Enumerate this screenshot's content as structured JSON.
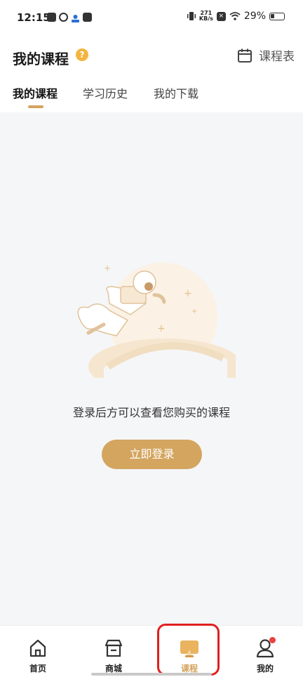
{
  "status_bar": {
    "time": "12:15",
    "speed_value": "271",
    "speed_unit": "KB/s",
    "battery": "29%"
  },
  "header": {
    "title": "我的课程",
    "help_glyph": "?",
    "schedule_label": "课程表"
  },
  "tabs": [
    {
      "label": "我的课程",
      "active": true
    },
    {
      "label": "学习历史",
      "active": false
    },
    {
      "label": "我的下载",
      "active": false
    }
  ],
  "empty_state": {
    "message": "登录后方可以查看您购买的课程",
    "button_label": "立即登录"
  },
  "bottom_nav": [
    {
      "label": "首页",
      "icon": "home-icon",
      "active": false
    },
    {
      "label": "商城",
      "icon": "store-icon",
      "active": false
    },
    {
      "label": "课程",
      "icon": "course-icon",
      "active": true
    },
    {
      "label": "我的",
      "icon": "profile-icon",
      "active": false,
      "badge": true
    }
  ],
  "colors": {
    "accent": "#d4a55f",
    "help": "#f3b53f",
    "badge": "#e8413e",
    "highlight": "#e02020"
  }
}
